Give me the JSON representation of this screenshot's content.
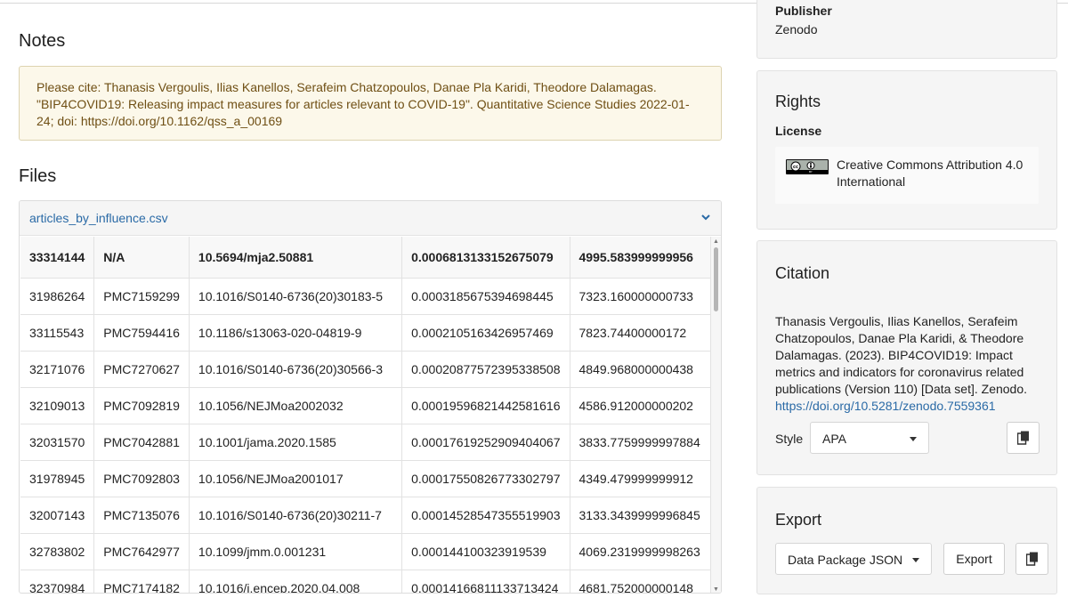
{
  "notes": {
    "heading": "Notes",
    "text": "Please cite: Thanasis Vergoulis, Ilias Kanellos, Serafeim Chatzopoulos, Danae Pla Karidi, Theodore Dalamagas. \"BIP4COVID19: Releasing impact measures for articles relevant to COVID-19\". Quantitative Science Studies 2022-01-24; doi: https://doi.org/10.1162/qss_a_00169"
  },
  "files": {
    "heading": "Files",
    "file_name": "articles_by_influence.csv",
    "header_row": [
      "33314144",
      "N/A",
      "10.5694/mja2.50881",
      "0.0006813133152675079",
      "4995.583999999956"
    ],
    "rows": [
      [
        "31986264",
        "PMC7159299",
        "10.1016/S0140-6736(20)30183-5",
        "0.0003185675394698445",
        "7323.160000000733"
      ],
      [
        "33115543",
        "PMC7594416",
        "10.1186/s13063-020-04819-9",
        "0.0002105163426957469",
        "7823.74400000172"
      ],
      [
        "32171076",
        "PMC7270627",
        "10.1016/S0140-6736(20)30566-3",
        "0.00020877572395338508",
        "4849.968000000438"
      ],
      [
        "32109013",
        "PMC7092819",
        "10.1056/NEJMoa2002032",
        "0.00019596821442581616",
        "4586.912000000202"
      ],
      [
        "32031570",
        "PMC7042881",
        "10.1001/jama.2020.1585",
        "0.00017619252909404067",
        "3833.7759999997884"
      ],
      [
        "31978945",
        "PMC7092803",
        "10.1056/NEJMoa2001017",
        "0.00017550826773302797",
        "4349.479999999912"
      ],
      [
        "32007143",
        "PMC7135076",
        "10.1016/S0140-6736(20)30211-7",
        "0.00014528547355519903",
        "3133.3439999996845"
      ],
      [
        "32783802",
        "PMC7642977",
        "10.1099/jmm.0.001231",
        "0.000144100323919539",
        "4069.2319999998263"
      ],
      [
        "32370984",
        "PMC7174182",
        "10.1016/j.encep.2020.04.008",
        "0.00014166811133713424",
        "4681.752000000148"
      ]
    ]
  },
  "publisher": {
    "label": "Publisher",
    "value": "Zenodo"
  },
  "rights": {
    "title": "Rights",
    "license_label": "License",
    "license_text": "Creative Commons Attribution 4.0 International",
    "badge_text": "BY"
  },
  "citation": {
    "title": "Citation",
    "text": "Thanasis Vergoulis, Ilias Kanellos, Serafeim Chatzopoulos, Danae Pla Karidi, & Theodore Dalamagas. (2023). BIP4COVID19: Impact metrics and indicators for coronavirus related publications (Version 110) [Data set]. Zenodo.",
    "link": "https://doi.org/10.5281/zenodo.7559361",
    "style_label": "Style",
    "style_value": "APA"
  },
  "export": {
    "title": "Export",
    "format_value": "Data Package JSON",
    "button_label": "Export"
  },
  "colors": {
    "link": "#2a6aa6",
    "note_bg": "#fcf8ea",
    "note_text": "#6f4f14",
    "card_bg": "#f5f5f5"
  }
}
